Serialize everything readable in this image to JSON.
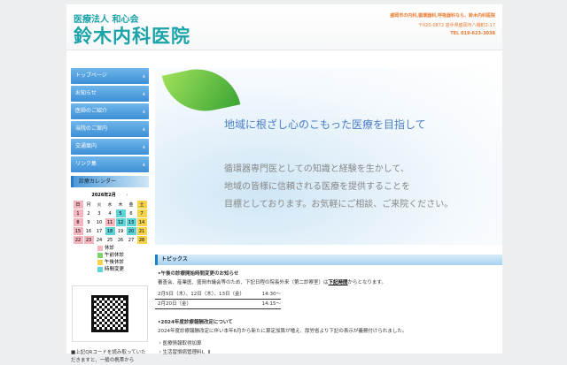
{
  "header": {
    "corp": "医療法人 和心会",
    "name": "鈴木内科医院",
    "tagline": "盛岡市の内科,循環器科,呼吸器科なら、鈴木内科医院",
    "address": "〒020-0872 岩手県盛岡市八幡町2-17",
    "tel": "TEL 019-623-3038"
  },
  "nav": [
    "トップページ",
    "お知らせ",
    "医師のご紹介",
    "当院のご案内",
    "交通案内",
    "リンク集"
  ],
  "calendar": {
    "heading": "診療カレンダー",
    "title": "2026年2月",
    "next": "›",
    "weekdays": [
      "日",
      "月",
      "火",
      "水",
      "木",
      "金",
      "土"
    ],
    "weeks": [
      [
        "1",
        "2",
        "3",
        "4",
        "5",
        "6",
        "7"
      ],
      [
        "8",
        "9",
        "10",
        "11",
        "12",
        "13",
        "14"
      ],
      [
        "15",
        "16",
        "17",
        "18",
        "19",
        "20",
        "21"
      ],
      [
        "22",
        "23",
        "24",
        "25",
        "26",
        "27",
        "28"
      ]
    ],
    "legend": [
      "休診",
      "午前休診",
      "午後休診",
      "時間変更"
    ],
    "colors": {
      "休診": "#f5b5bf",
      "午前休診": "#7cd36b",
      "午後休診": "#f7d24a",
      "時間変更": "#5fd3d8"
    }
  },
  "qr_text": "■上記QRコードを読み取っていただきますと、一般の携帯から",
  "hero": {
    "headline": "地域に根ざし心のこもった医療を目指して",
    "lines": [
      "循環器専門医としての知識と経験を生かして、",
      "地域の皆様に信頼される医療を提供することを",
      "目標としております。お気軽にご相談、ご来院ください。"
    ]
  },
  "topics": {
    "heading": "トピックス",
    "item1": {
      "title": "•午後の診療開始時間変更のお知らせ",
      "body_pre": "審査会、産業医、盛岡市議会等のため、下記日程の院長外来（第二診察室）は",
      "body_link": "下記時間",
      "body_post": "からとなります。",
      "rows": [
        {
          "date": "2月5日（木）、12日（木）、13日（金）",
          "time": "14:30〜"
        },
        {
          "date": "2月20日（金）",
          "time": "14:15〜"
        }
      ]
    },
    "item2": {
      "title": "•2024年度診療報酬改定について",
      "body": "2024年度診療報酬改定に伴い本年6月から新たに算定加算が増え、厚労省より下記の表示が義務付けられました。",
      "list": [
        "・医療情報取得加算",
        "・生活習慣病管理料Ⅰ、Ⅱ"
      ]
    }
  }
}
